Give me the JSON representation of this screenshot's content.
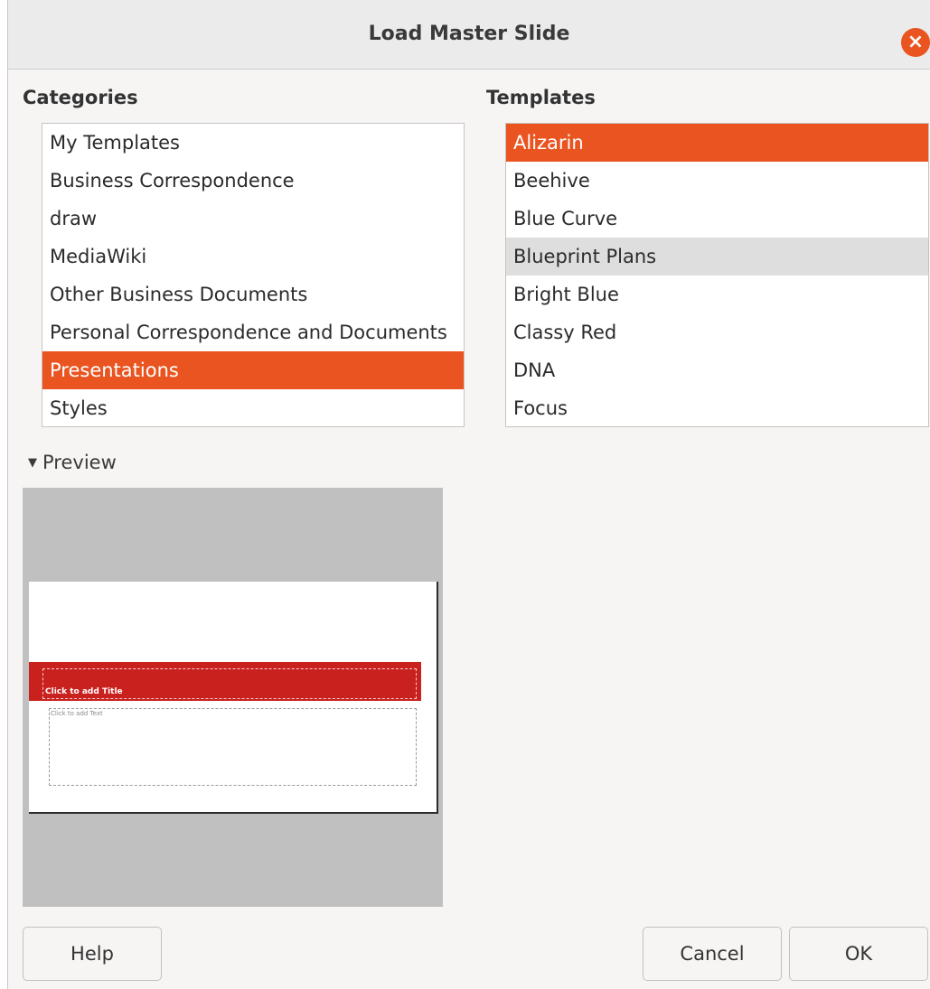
{
  "dialog": {
    "title": "Load Master Slide",
    "close_symbol": "×"
  },
  "categories": {
    "label": "Categories",
    "items": [
      {
        "label": "My Templates",
        "state": "normal"
      },
      {
        "label": "Business Correspondence",
        "state": "normal"
      },
      {
        "label": "draw",
        "state": "normal"
      },
      {
        "label": "MediaWiki",
        "state": "normal"
      },
      {
        "label": "Other Business Documents",
        "state": "normal"
      },
      {
        "label": "Personal Correspondence and Documents",
        "state": "normal"
      },
      {
        "label": "Presentations",
        "state": "selected"
      },
      {
        "label": "Styles",
        "state": "normal"
      }
    ]
  },
  "templates": {
    "label": "Templates",
    "items": [
      {
        "label": "Alizarin",
        "state": "selected"
      },
      {
        "label": "Beehive",
        "state": "normal"
      },
      {
        "label": "Blue Curve",
        "state": "normal"
      },
      {
        "label": "Blueprint Plans",
        "state": "hover"
      },
      {
        "label": "Bright Blue",
        "state": "normal"
      },
      {
        "label": "Classy Red",
        "state": "normal"
      },
      {
        "label": "DNA",
        "state": "normal"
      },
      {
        "label": "Focus",
        "state": "normal"
      }
    ]
  },
  "preview": {
    "toggle_label": "Preview",
    "expanded": true,
    "slide_title_placeholder": "Click to add Title",
    "slide_text_placeholder": "Click to add Text"
  },
  "buttons": {
    "help": "Help",
    "cancel": "Cancel",
    "ok": "OK"
  },
  "colors": {
    "accent": "#e95420",
    "slide_band": "#c9211e",
    "hover": "#dedede"
  }
}
